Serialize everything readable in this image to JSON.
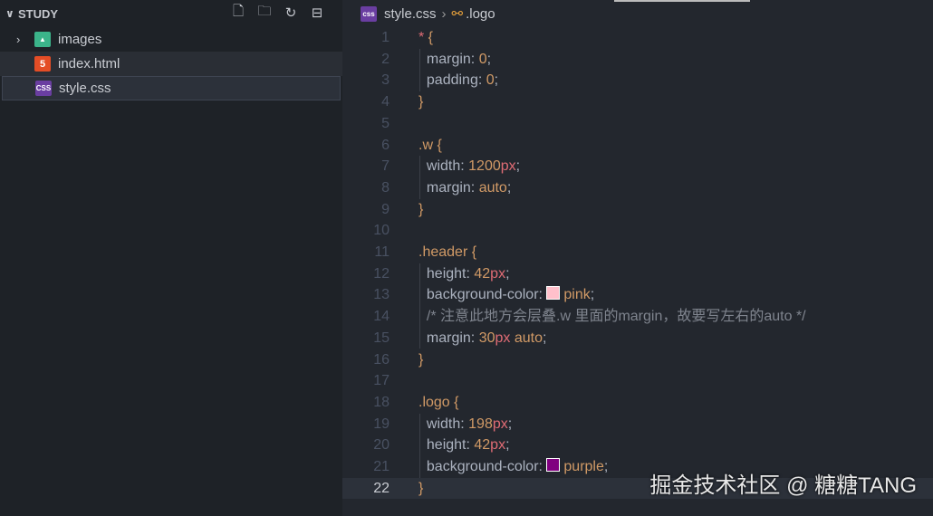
{
  "sidebar": {
    "title": "STUDY",
    "actions": [
      "new-file",
      "new-folder",
      "refresh",
      "collapse-all"
    ],
    "items": [
      {
        "label": "images",
        "type": "folder"
      },
      {
        "label": "index.html",
        "type": "html"
      },
      {
        "label": "style.css",
        "type": "css"
      }
    ]
  },
  "breadcrumb": {
    "file": "style.css",
    "symbol": ".logo",
    "file_icon_text": "css"
  },
  "editor": {
    "current_line": 22,
    "lines": [
      [
        [
          "*",
          "star"
        ],
        [
          " {",
          "brace"
        ]
      ],
      [
        [
          "  margin: ",
          "prop"
        ],
        [
          "0",
          "num"
        ],
        [
          ";",
          "punc"
        ]
      ],
      [
        [
          "  padding: ",
          "prop"
        ],
        [
          "0",
          "num"
        ],
        [
          ";",
          "punc"
        ]
      ],
      [
        [
          "}",
          "brace"
        ]
      ],
      [],
      [
        [
          ".w {",
          "sel"
        ]
      ],
      [
        [
          "  width: ",
          "prop"
        ],
        [
          "1200",
          "num"
        ],
        [
          "px",
          "unit"
        ],
        [
          ";",
          "punc"
        ]
      ],
      [
        [
          "  margin: ",
          "prop"
        ],
        [
          "auto",
          "val"
        ],
        [
          ";",
          "punc"
        ]
      ],
      [
        [
          "}",
          "brace"
        ]
      ],
      [],
      [
        [
          ".header {",
          "sel"
        ]
      ],
      [
        [
          "  height: ",
          "prop"
        ],
        [
          "42",
          "num"
        ],
        [
          "px",
          "unit"
        ],
        [
          ";",
          "punc"
        ]
      ],
      [
        [
          "  background-color: ",
          "prop"
        ],
        [
          "#ffc0cb",
          "swatch"
        ],
        [
          "pink",
          "val"
        ],
        [
          ";",
          "punc"
        ]
      ],
      [
        [
          "  /* 注意此地方会层叠.w 里面的margin，故要写左右的auto */",
          "cmt"
        ]
      ],
      [
        [
          "  margin: ",
          "prop"
        ],
        [
          "30",
          "num"
        ],
        [
          "px",
          "unit"
        ],
        [
          " auto",
          "val"
        ],
        [
          ";",
          "punc"
        ]
      ],
      [
        [
          "}",
          "brace"
        ]
      ],
      [],
      [
        [
          ".logo {",
          "sel"
        ]
      ],
      [
        [
          "  width: ",
          "prop"
        ],
        [
          "198",
          "num"
        ],
        [
          "px",
          "unit"
        ],
        [
          ";",
          "punc"
        ]
      ],
      [
        [
          "  height: ",
          "prop"
        ],
        [
          "42",
          "num"
        ],
        [
          "px",
          "unit"
        ],
        [
          ";",
          "punc"
        ]
      ],
      [
        [
          "  background-color: ",
          "prop"
        ],
        [
          "#800080",
          "swatch"
        ],
        [
          "purple",
          "val"
        ],
        [
          ";",
          "punc"
        ]
      ],
      [
        [
          "}",
          "brace"
        ]
      ]
    ]
  },
  "watermark": "掘金技术社区 @ 糖糖TANG"
}
